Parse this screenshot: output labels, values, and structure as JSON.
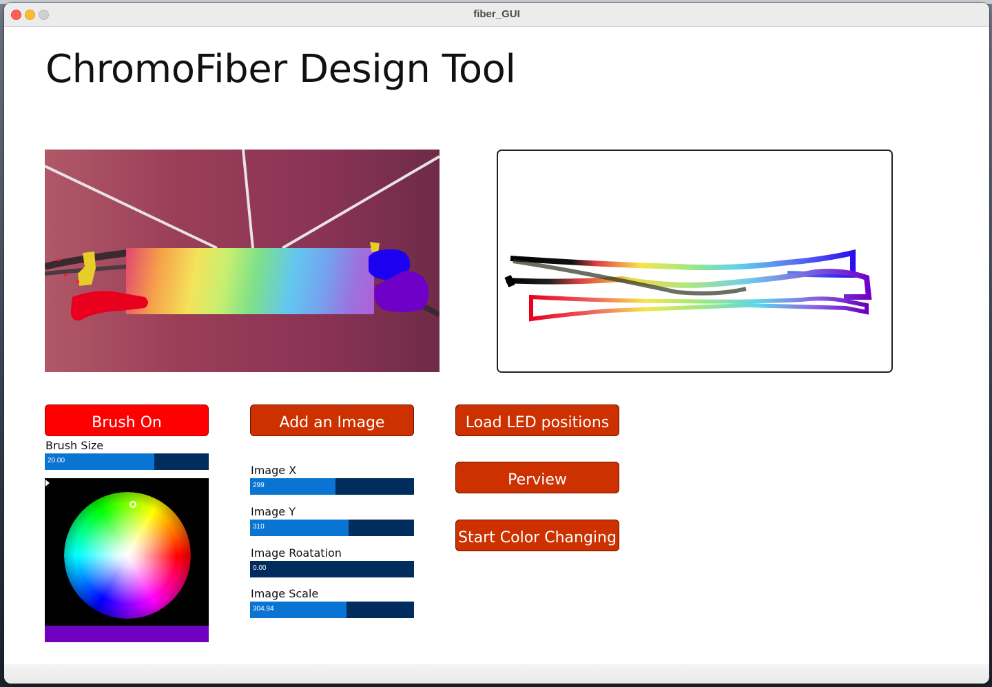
{
  "window": {
    "title": "fiber_GUI"
  },
  "app": {
    "title": "ChromoFiber Design Tool"
  },
  "buttons": {
    "brush": "Brush On",
    "add_image": "Add an Image",
    "load_led": "Load LED positions",
    "preview": "Perview",
    "start_color": "Start Color Changing"
  },
  "sliders": {
    "brush_size": {
      "label": "Brush Size",
      "value": "20.00",
      "fraction": 0.67
    },
    "image_x": {
      "label": "Image X",
      "value": "299",
      "fraction": 0.52
    },
    "image_y": {
      "label": "Image Y",
      "value": "310",
      "fraction": 0.6
    },
    "image_rotation": {
      "label": "Image Roatation",
      "value": "0.00",
      "fraction": 0.0
    },
    "image_scale": {
      "label": "Image Scale",
      "value": "304.94",
      "fraction": 0.59
    }
  },
  "colors": {
    "button_orange": "#cd3100",
    "button_red": "#fe0000",
    "slider_fill": "#0a74d2",
    "slider_track": "#002c5e",
    "selected_color": "#7200c0"
  }
}
